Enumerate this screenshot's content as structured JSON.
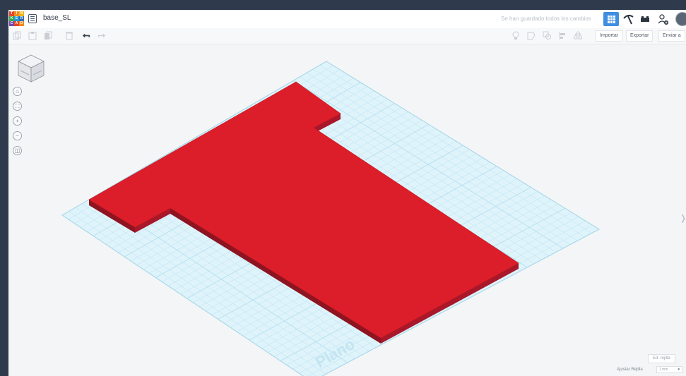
{
  "app": {
    "logo_letters": [
      "T",
      "I",
      "N",
      "K",
      "E",
      "R",
      "C",
      "A",
      "D"
    ],
    "logo_colors": [
      "#e8442d",
      "#f28a1e",
      "#f3b316",
      "#3ea84a",
      "#1e9ad6",
      "#2f6fb8",
      "#7a4cae",
      "#e8442d",
      "#f28a1e"
    ],
    "document_title": "base_SL",
    "save_status": "Se han guardado todos los cambios"
  },
  "header_icons": [
    "grid-view-icon",
    "pickaxe-icon",
    "bricks-icon",
    "user-add-icon",
    "avatar"
  ],
  "toolbar": {
    "left_tools": [
      "copy-icon",
      "paste-icon",
      "duplicate-icon",
      "delete-icon",
      "undo-icon",
      "redo-icon"
    ],
    "right_tools": [
      "light-bulb-icon",
      "shape-outline-icon",
      "group-shapes-icon",
      "align-icon",
      "mirror-icon"
    ],
    "import_label": "Importar",
    "export_label": "Exportar",
    "send_label": "Enviar a"
  },
  "navigation": {
    "home_icon": "⌂",
    "fit_icon": "⛶",
    "zoom_in_icon": "+",
    "zoom_out_icon": "−",
    "ortho_icon": "◫"
  },
  "workplane": {
    "label": "Plano",
    "grid_color": "#a9dcee",
    "shape_color": "#dc1e2a",
    "shape_side_color": "#8d1420"
  },
  "grid_settings": {
    "edit_grid_label": "Ed. rejilla",
    "snap_label": "Ajustar Rejilla",
    "snap_value": "1 mm"
  }
}
